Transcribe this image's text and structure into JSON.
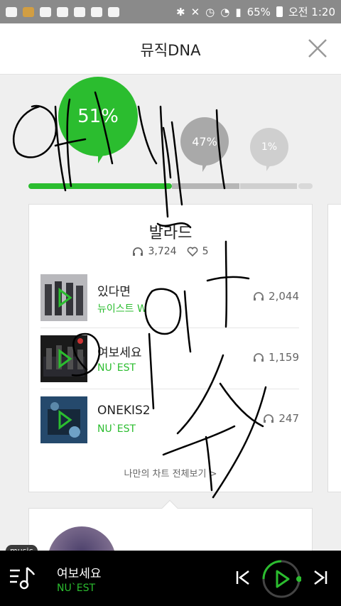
{
  "status_bar": {
    "battery": "65%",
    "time": "오전 1:20"
  },
  "header": {
    "title": "뮤직DNA"
  },
  "dna": {
    "percents": [
      "51%",
      "47%",
      "1%"
    ]
  },
  "card": {
    "genre": "발라드",
    "listen_count": "3,724",
    "like_count": "5",
    "tracks": [
      {
        "title": "있다면",
        "artist": "뉴이스트 W",
        "plays": "2,044"
      },
      {
        "title": "여보세요",
        "artist": "NU`EST",
        "plays": "1,159"
      },
      {
        "title": "ONEKIS2",
        "artist": "NU`EST",
        "plays": "247"
      }
    ],
    "more_link": "나만의 차트 전체보기 >"
  },
  "player": {
    "tag": "music",
    "title": "여보세요",
    "artist": "NU`EST"
  },
  "colors": {
    "accent": "#2bbd2f",
    "gray_bubble": "#a9a9a9",
    "light_bubble": "#cfcfcf"
  }
}
